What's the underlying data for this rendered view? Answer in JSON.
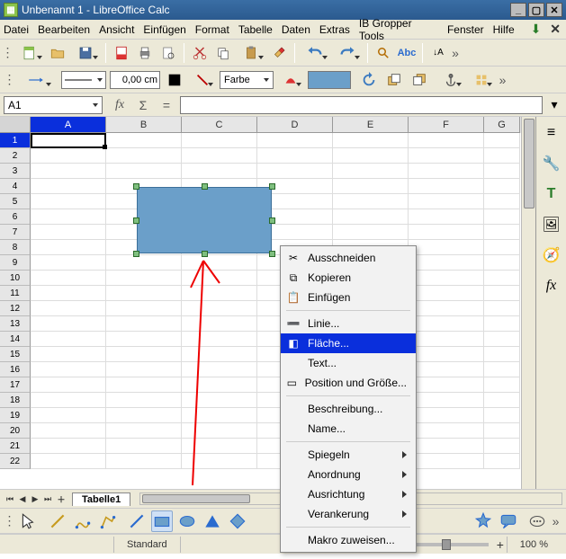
{
  "title": "Unbenannt 1 - LibreOffice Calc",
  "menus": [
    "Datei",
    "Bearbeiten",
    "Ansicht",
    "Einfügen",
    "Format",
    "Tabelle",
    "Daten",
    "Extras",
    "IB Gropper Tools",
    "Fenster",
    "Hilfe"
  ],
  "lineWidth": "0,00 cm",
  "colorLabel": "Farbe",
  "cell_ref": "A1",
  "columns": [
    "A",
    "B",
    "C",
    "D",
    "E",
    "F",
    "G"
  ],
  "rows": [
    "1",
    "2",
    "3",
    "4",
    "5",
    "6",
    "7",
    "8",
    "9",
    "10",
    "11",
    "12",
    "13",
    "14",
    "15",
    "16",
    "17",
    "18",
    "19",
    "20",
    "21",
    "22"
  ],
  "tab": "Tabelle1",
  "context_menu": {
    "cut": "Ausschneiden",
    "copy": "Kopieren",
    "paste": "Einfügen",
    "line": "Linie...",
    "area": "Fläche...",
    "text": "Text...",
    "possize": "Position und Größe...",
    "desc": "Beschreibung...",
    "name": "Name...",
    "flip": "Spiegeln",
    "arrange": "Anordnung",
    "align": "Ausrichtung",
    "anchor": "Verankerung",
    "macro": "Makro zuweisen..."
  },
  "status_mode": "Standard",
  "zoom_label": "100 %"
}
